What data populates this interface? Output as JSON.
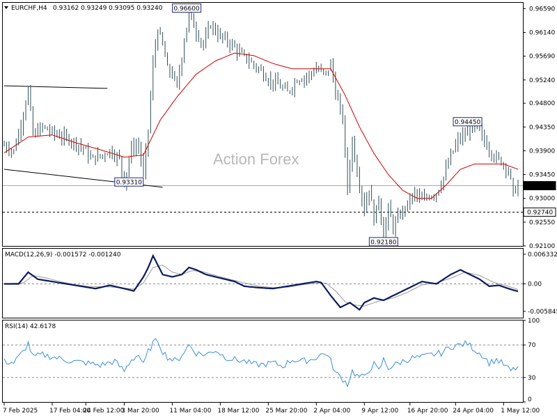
{
  "header": {
    "symbol": "EURCHF,H4",
    "ohlc": "0.93162 0.93249 0.93095 0.93240"
  },
  "watermark": "Action Forex",
  "colors": {
    "candle": "#2e4e57",
    "ma": "#cc0000",
    "macd": "#0a1a5c",
    "macd_signal": "#9a9a9a",
    "rsi": "#3a8fd6",
    "grid_dash": "#888888",
    "trendline": "#000000",
    "label_border": "#1a237e"
  },
  "chart_data": [
    {
      "type": "candlestick",
      "panel": "price",
      "ylim": [
        0.921,
        0.967
      ],
      "y_ticks": [
        "0.96590",
        "0.96140",
        "0.95690",
        "0.95240",
        "0.94800",
        "0.94350",
        "0.93900",
        "0.93450",
        "0.93000",
        "0.92550",
        "0.92100"
      ],
      "y_tick_values": [
        0.9659,
        0.9614,
        0.9569,
        0.9524,
        0.948,
        0.9435,
        0.939,
        0.9345,
        0.93,
        0.9255,
        0.921
      ],
      "current_price": {
        "value": 0.9324,
        "label": "0.93240"
      },
      "support_line": {
        "value": 0.9274,
        "label": "0.92740"
      },
      "annotations": [
        {
          "label": "0.96600",
          "value": 0.966,
          "bar": 76
        },
        {
          "label": "0.93310",
          "value": 0.9331,
          "bar": 52
        },
        {
          "label": "0.92180",
          "value": 0.9218,
          "bar": 158
        },
        {
          "label": "0.94450",
          "value": 0.9445,
          "bar": 193
        }
      ],
      "trendlines": [
        {
          "from": {
            "bar": 0,
            "value": 0.9513
          },
          "to": {
            "bar": 43,
            "value": 0.9508
          }
        },
        {
          "from": {
            "bar": 0,
            "value": 0.9355
          },
          "to": {
            "bar": 66,
            "value": 0.9321
          }
        }
      ],
      "moving_average_anchors": [
        [
          0,
          0.9386
        ],
        [
          10,
          0.9416
        ],
        [
          20,
          0.942
        ],
        [
          30,
          0.9405
        ],
        [
          40,
          0.9392
        ],
        [
          50,
          0.9378
        ],
        [
          58,
          0.9382
        ],
        [
          65,
          0.9448
        ],
        [
          72,
          0.9492
        ],
        [
          80,
          0.9535
        ],
        [
          88,
          0.956
        ],
        [
          96,
          0.9575
        ],
        [
          104,
          0.957
        ],
        [
          112,
          0.9555
        ],
        [
          120,
          0.9545
        ],
        [
          130,
          0.9545
        ],
        [
          136,
          0.9545
        ],
        [
          142,
          0.9495
        ],
        [
          148,
          0.9435
        ],
        [
          154,
          0.9385
        ],
        [
          160,
          0.9345
        ],
        [
          166,
          0.9315
        ],
        [
          172,
          0.93
        ],
        [
          178,
          0.93
        ],
        [
          184,
          0.9325
        ],
        [
          190,
          0.9355
        ],
        [
          196,
          0.9365
        ],
        [
          202,
          0.9365
        ],
        [
          208,
          0.9365
        ],
        [
          214,
          0.9355
        ]
      ],
      "price_anchors": [
        [
          0,
          0.94
        ],
        [
          4,
          0.939
        ],
        [
          7,
          0.944
        ],
        [
          10,
          0.9505
        ],
        [
          12,
          0.942
        ],
        [
          16,
          0.9435
        ],
        [
          22,
          0.942
        ],
        [
          28,
          0.941
        ],
        [
          33,
          0.9395
        ],
        [
          36,
          0.9375
        ],
        [
          40,
          0.938
        ],
        [
          44,
          0.939
        ],
        [
          48,
          0.9375
        ],
        [
          50,
          0.933
        ],
        [
          53,
          0.9395
        ],
        [
          56,
          0.94
        ],
        [
          58,
          0.9345
        ],
        [
          60,
          0.943
        ],
        [
          62,
          0.9555
        ],
        [
          64,
          0.962
        ],
        [
          66,
          0.959
        ],
        [
          68,
          0.9545
        ],
        [
          70,
          0.9535
        ],
        [
          72,
          0.951
        ],
        [
          75,
          0.96
        ],
        [
          77,
          0.965
        ],
        [
          80,
          0.9615
        ],
        [
          83,
          0.959
        ],
        [
          86,
          0.963
        ],
        [
          89,
          0.961
        ],
        [
          92,
          0.96
        ],
        [
          95,
          0.959
        ],
        [
          98,
          0.9575
        ],
        [
          102,
          0.956
        ],
        [
          106,
          0.9545
        ],
        [
          110,
          0.9525
        ],
        [
          114,
          0.9515
        ],
        [
          118,
          0.95
        ],
        [
          122,
          0.9525
        ],
        [
          126,
          0.953
        ],
        [
          130,
          0.9545
        ],
        [
          134,
          0.9535
        ],
        [
          136,
          0.9555
        ],
        [
          138,
          0.95
        ],
        [
          141,
          0.945
        ],
        [
          143,
          0.932
        ],
        [
          145,
          0.941
        ],
        [
          147,
          0.935
        ],
        [
          150,
          0.928
        ],
        [
          152,
          0.932
        ],
        [
          154,
          0.926
        ],
        [
          156,
          0.93
        ],
        [
          158,
          0.9225
        ],
        [
          160,
          0.928
        ],
        [
          162,
          0.9245
        ],
        [
          165,
          0.927
        ],
        [
          168,
          0.929
        ],
        [
          171,
          0.931
        ],
        [
          174,
          0.9295
        ],
        [
          177,
          0.9305
        ],
        [
          180,
          0.931
        ],
        [
          183,
          0.934
        ],
        [
          186,
          0.938
        ],
        [
          189,
          0.941
        ],
        [
          192,
          0.942
        ],
        [
          195,
          0.9435
        ],
        [
          198,
          0.9425
        ],
        [
          201,
          0.94
        ],
        [
          204,
          0.938
        ],
        [
          207,
          0.937
        ],
        [
          210,
          0.9355
        ],
        [
          212,
          0.931
        ],
        [
          214,
          0.9324
        ]
      ],
      "x_labels": [
        "7 Feb 2025",
        "17 Feb 04:00",
        "24 Feb 12:00",
        "3 Mar 20:00",
        "11 Mar 04:00",
        "18 Mar 12:00",
        "25 Mar 20:00",
        "2 Apr 04:00",
        "9 Apr 12:00",
        "16 Apr 20:00",
        "24 Apr 04:00",
        "1 May 12:00"
      ],
      "x_label_bars": [
        0,
        20,
        34,
        50,
        70,
        90,
        110,
        130,
        150,
        169,
        188,
        208
      ]
    },
    {
      "type": "line",
      "panel": "macd",
      "title": "MACD(12,26,9) -0.001572 -0.001240",
      "ylim": [
        -0.0072,
        0.0075
      ],
      "y_ticks": [
        "0.006332",
        "0.00",
        "-0.005845"
      ],
      "y_tick_values": [
        0.006332,
        0.0,
        -0.005845
      ],
      "series": [
        {
          "name": "MACD",
          "anchors": [
            [
              0,
              0.0
            ],
            [
              6,
              0.0
            ],
            [
              10,
              0.0025
            ],
            [
              14,
              0.001
            ],
            [
              20,
              0.0005
            ],
            [
              26,
              0.0
            ],
            [
              32,
              -0.0005
            ],
            [
              38,
              -0.001
            ],
            [
              44,
              -0.0003
            ],
            [
              50,
              -0.001
            ],
            [
              54,
              -0.0015
            ],
            [
              56,
              0.0
            ],
            [
              58,
              0.0015
            ],
            [
              60,
              0.0035
            ],
            [
              62,
              0.006
            ],
            [
              64,
              0.004
            ],
            [
              66,
              0.002
            ],
            [
              70,
              0.0015
            ],
            [
              74,
              0.002
            ],
            [
              77,
              0.0035
            ],
            [
              80,
              0.003
            ],
            [
              84,
              0.002
            ],
            [
              88,
              0.0015
            ],
            [
              92,
              0.001
            ],
            [
              96,
              0.0005
            ],
            [
              100,
              -0.0005
            ],
            [
              106,
              -0.0008
            ],
            [
              112,
              -0.001
            ],
            [
              118,
              -0.0005
            ],
            [
              124,
              0.0
            ],
            [
              130,
              0.0005
            ],
            [
              132,
              0.0003
            ],
            [
              136,
              -0.0025
            ],
            [
              140,
              -0.005
            ],
            [
              144,
              -0.004
            ],
            [
              148,
              -0.0055
            ],
            [
              150,
              -0.004
            ],
            [
              154,
              -0.003
            ],
            [
              158,
              -0.0035
            ],
            [
              162,
              -0.0025
            ],
            [
              166,
              -0.0015
            ],
            [
              170,
              -0.0005
            ],
            [
              174,
              0.0005
            ],
            [
              180,
              0.0
            ],
            [
              186,
              0.002
            ],
            [
              190,
              0.003
            ],
            [
              194,
              0.002
            ],
            [
              198,
              0.001
            ],
            [
              202,
              -0.0005
            ],
            [
              206,
              -0.0003
            ],
            [
              210,
              -0.001
            ],
            [
              214,
              -0.0016
            ]
          ]
        },
        {
          "name": "Signal",
          "anchors": [
            [
              0,
              0.0
            ],
            [
              8,
              0.0002
            ],
            [
              12,
              0.0018
            ],
            [
              18,
              0.0012
            ],
            [
              24,
              0.0004
            ],
            [
              30,
              -0.0002
            ],
            [
              36,
              -0.0006
            ],
            [
              42,
              -0.0006
            ],
            [
              48,
              -0.0008
            ],
            [
              54,
              -0.0011
            ],
            [
              58,
              0.0002
            ],
            [
              62,
              0.0035
            ],
            [
              66,
              0.004
            ],
            [
              70,
              0.0025
            ],
            [
              74,
              0.002
            ],
            [
              78,
              0.0028
            ],
            [
              82,
              0.0027
            ],
            [
              88,
              0.0018
            ],
            [
              94,
              0.001
            ],
            [
              100,
              0.0002
            ],
            [
              106,
              -0.0005
            ],
            [
              112,
              -0.0008
            ],
            [
              118,
              -0.0007
            ],
            [
              124,
              -0.0002
            ],
            [
              130,
              0.0002
            ],
            [
              134,
              0.0002
            ],
            [
              138,
              -0.0015
            ],
            [
              142,
              -0.0038
            ],
            [
              146,
              -0.0045
            ],
            [
              150,
              -0.0047
            ],
            [
              156,
              -0.0037
            ],
            [
              162,
              -0.003
            ],
            [
              168,
              -0.0018
            ],
            [
              174,
              -0.0002
            ],
            [
              180,
              0.0002
            ],
            [
              186,
              0.0012
            ],
            [
              192,
              0.0025
            ],
            [
              198,
              0.0018
            ],
            [
              204,
              0.0003
            ],
            [
              210,
              -0.0005
            ],
            [
              214,
              -0.0012
            ]
          ]
        }
      ]
    },
    {
      "type": "line",
      "panel": "rsi",
      "title": "RSI(14) 42.6178",
      "ylim": [
        0,
        100
      ],
      "y_ticks": [
        "100",
        "70",
        "30",
        "0"
      ],
      "y_tick_values": [
        100,
        70,
        30,
        0
      ],
      "levels": [
        70,
        30
      ],
      "series": [
        {
          "name": "RSI",
          "anchors": [
            [
              0,
              50
            ],
            [
              4,
              48
            ],
            [
              8,
              62
            ],
            [
              10,
              72
            ],
            [
              12,
              55
            ],
            [
              16,
              58
            ],
            [
              22,
              54
            ],
            [
              28,
              50
            ],
            [
              34,
              48
            ],
            [
              40,
              45
            ],
            [
              46,
              50
            ],
            [
              50,
              38
            ],
            [
              53,
              52
            ],
            [
              56,
              58
            ],
            [
              58,
              45
            ],
            [
              60,
              62
            ],
            [
              62,
              72
            ],
            [
              64,
              76
            ],
            [
              66,
              62
            ],
            [
              68,
              55
            ],
            [
              70,
              52
            ],
            [
              72,
              50
            ],
            [
              75,
              62
            ],
            [
              77,
              70
            ],
            [
              80,
              60
            ],
            [
              84,
              58
            ],
            [
              88,
              64
            ],
            [
              92,
              55
            ],
            [
              96,
              52
            ],
            [
              100,
              50
            ],
            [
              104,
              46
            ],
            [
              108,
              46
            ],
            [
              112,
              48
            ],
            [
              116,
              44
            ],
            [
              120,
              52
            ],
            [
              124,
              50
            ],
            [
              128,
              52
            ],
            [
              132,
              58
            ],
            [
              134,
              60
            ],
            [
              136,
              50
            ],
            [
              138,
              36
            ],
            [
              141,
              28
            ],
            [
              143,
              22
            ],
            [
              145,
              38
            ],
            [
              147,
              32
            ],
            [
              150,
              30
            ],
            [
              152,
              40
            ],
            [
              154,
              46
            ],
            [
              156,
              38
            ],
            [
              158,
              52
            ],
            [
              160,
              42
            ],
            [
              163,
              46
            ],
            [
              166,
              50
            ],
            [
              170,
              54
            ],
            [
              174,
              55
            ],
            [
              178,
              58
            ],
            [
              182,
              60
            ],
            [
              186,
              68
            ],
            [
              190,
              70
            ],
            [
              193,
              72
            ],
            [
              196,
              64
            ],
            [
              199,
              58
            ],
            [
              202,
              48
            ],
            [
              205,
              52
            ],
            [
              208,
              46
            ],
            [
              211,
              38
            ],
            [
              214,
              43
            ]
          ]
        }
      ]
    }
  ]
}
